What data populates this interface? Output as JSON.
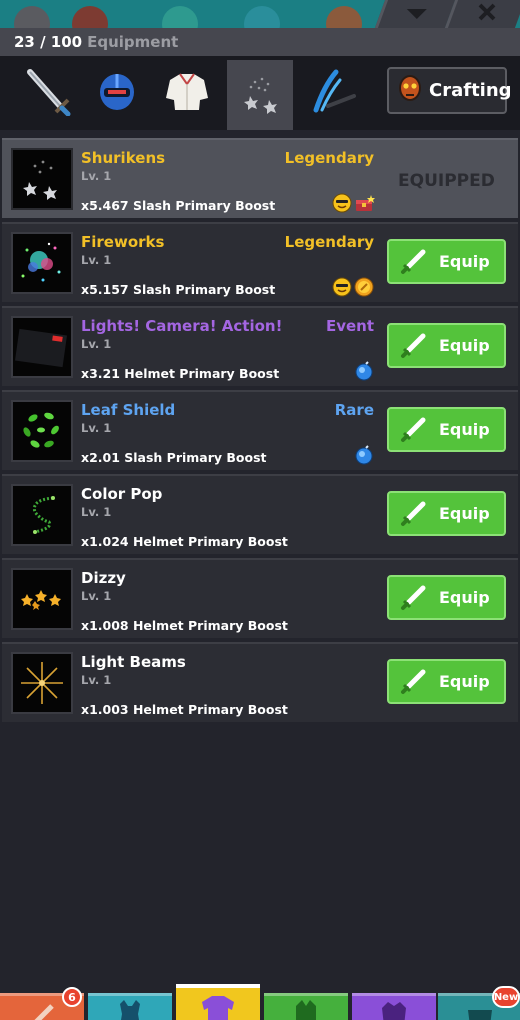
{
  "header": {
    "count": "23 / 100",
    "label": "Equipment"
  },
  "categories": [
    {
      "name": "sword",
      "active": false
    },
    {
      "name": "helmet",
      "active": false
    },
    {
      "name": "shirt",
      "active": false
    },
    {
      "name": "shurikens",
      "active": true
    },
    {
      "name": "slash-effect",
      "active": false
    }
  ],
  "crafting_label": "Crafting",
  "colors": {
    "legendary": "#f2c027",
    "event": "#a466e2",
    "rare": "#5ea4f1",
    "common": "#ffffff",
    "equip_green": "#54c33b"
  },
  "items": [
    {
      "name": "Shurikens",
      "level": "Lv. 1",
      "boost": "x5.467 Slash Primary Boost",
      "rarity": "Legendary",
      "rarity_color": "#f2c027",
      "badges": [
        "emoji-face-icon",
        "treasure-chest-icon"
      ],
      "equipped": true,
      "status": "EQUIPPED"
    },
    {
      "name": "Fireworks",
      "level": "Lv. 1",
      "boost": "x5.157 Slash Primary Boost",
      "rarity": "Legendary",
      "rarity_color": "#f2c027",
      "badges": [
        "emoji-face-icon",
        "gold-coin-icon"
      ],
      "equipped": false,
      "action": "Equip"
    },
    {
      "name": "Lights! Camera! Action!",
      "level": "Lv. 1",
      "boost": "x3.21 Helmet Primary Boost",
      "rarity": "Event",
      "rarity_color": "#a466e2",
      "name_color": "#a466e2",
      "badges": [
        "blue-orb-icon"
      ],
      "equipped": false,
      "action": "Equip"
    },
    {
      "name": "Leaf Shield",
      "level": "Lv. 1",
      "boost": "x2.01 Slash Primary Boost",
      "rarity": "Rare",
      "rarity_color": "#5ea4f1",
      "name_color": "#5ea4f1",
      "badges": [
        "blue-orb-icon"
      ],
      "equipped": false,
      "action": "Equip"
    },
    {
      "name": "Color Pop",
      "level": "Lv. 1",
      "boost": "x1.024 Helmet Primary Boost",
      "rarity": "",
      "equipped": false,
      "action": "Equip"
    },
    {
      "name": "Dizzy",
      "level": "Lv. 1",
      "boost": "x1.008 Helmet Primary Boost",
      "rarity": "",
      "equipped": false,
      "action": "Equip"
    },
    {
      "name": "Light Beams",
      "level": "Lv. 1",
      "boost": "x1.003 Helmet Primary Boost",
      "rarity": "",
      "equipped": false,
      "action": "Equip"
    }
  ],
  "bottom_nav": [
    {
      "name": "weapons",
      "color": "#e4653b",
      "badge": "6"
    },
    {
      "name": "pets",
      "color": "#2fa7b8"
    },
    {
      "name": "equipment",
      "color": "#f1c71e",
      "active": true
    },
    {
      "name": "creatures",
      "color": "#45b03d"
    },
    {
      "name": "characters",
      "color": "#8a4fd8"
    },
    {
      "name": "more",
      "color": "#2a8f95",
      "badge": "New"
    }
  ]
}
